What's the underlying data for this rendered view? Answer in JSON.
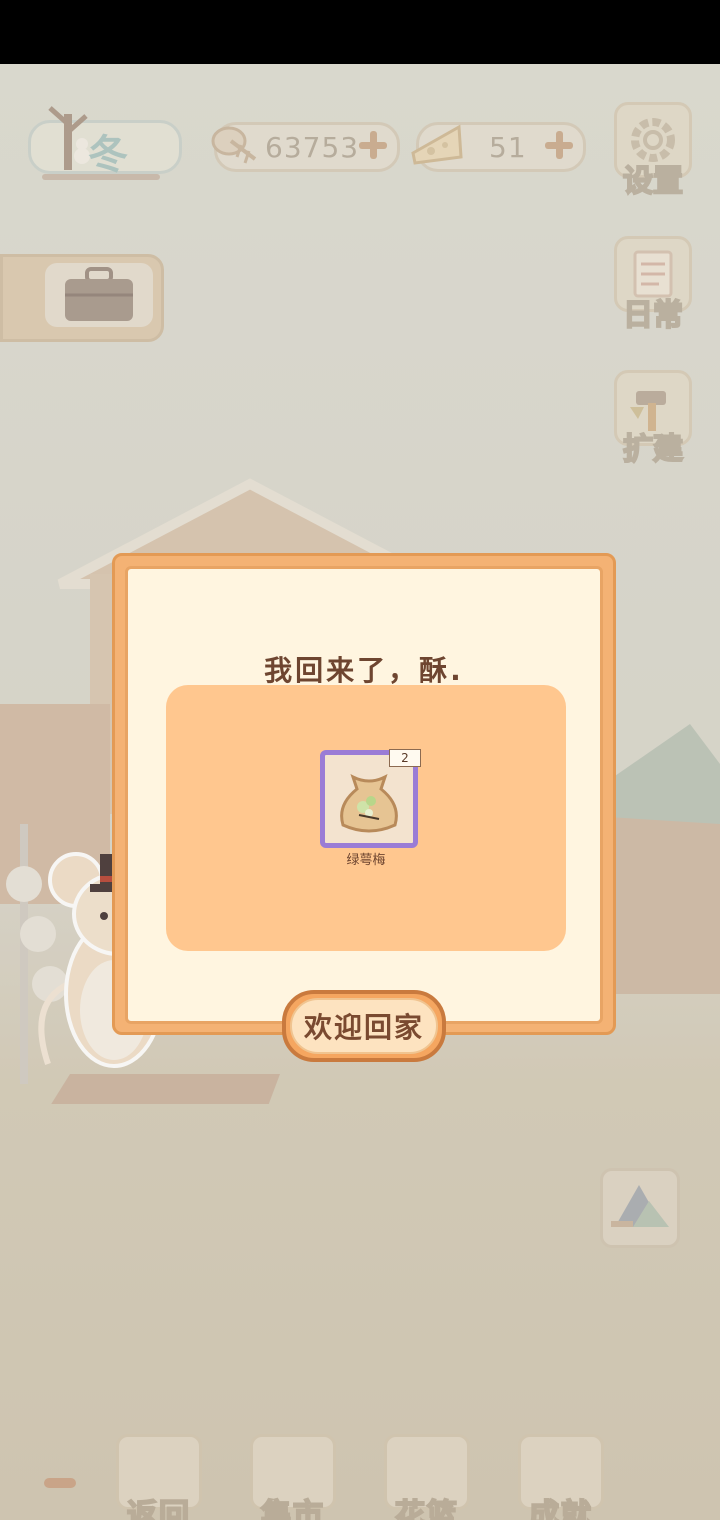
{
  "season": {
    "label": "冬"
  },
  "currencies": {
    "fish_bones": {
      "value": "63753",
      "icon": "fishbone-icon"
    },
    "cheese": {
      "value": "51",
      "icon": "cheese-icon"
    }
  },
  "side_menu": {
    "settings": "设置",
    "daily": "日常",
    "expand": "扩建"
  },
  "dialog": {
    "title": "我回来了，酥.",
    "item": {
      "name": "绿萼梅",
      "count": "2",
      "icon": "seed-bag-icon"
    },
    "confirm_label": "欢迎回家"
  },
  "bottom_nav": {
    "back": "返回",
    "market": "集市",
    "flower_basket": "花篮",
    "achievements": "成就"
  },
  "colors": {
    "dialog_frame": "#f4b274",
    "dialog_bg": "#fff5e0",
    "reward_panel": "#ffc78f",
    "item_rarity_border": "#9a7cd6",
    "title_text": "#6e4530"
  }
}
